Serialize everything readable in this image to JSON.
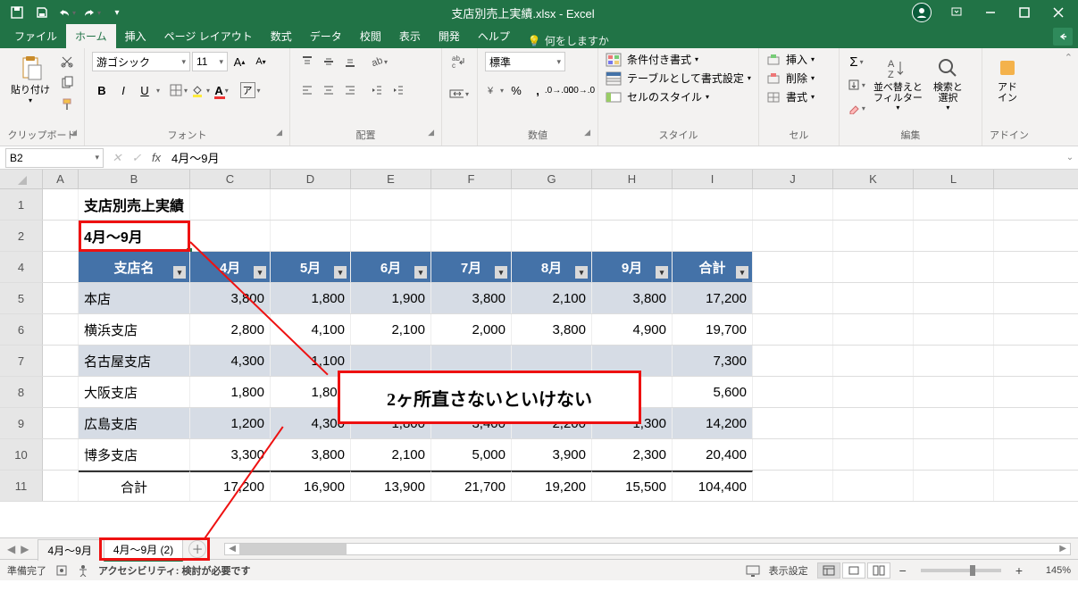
{
  "titlebar": {
    "title": "支店別売上実績.xlsx - Excel"
  },
  "tabs": {
    "file": "ファイル",
    "home": "ホーム",
    "insert": "挿入",
    "pagelayout": "ページ レイアウト",
    "formulas": "数式",
    "data": "データ",
    "review": "校閲",
    "view": "表示",
    "developer": "開発",
    "help": "ヘルプ",
    "tellme": "何をしますか"
  },
  "ribbon": {
    "clipboard": {
      "paste": "貼り付け",
      "label": "クリップボード"
    },
    "font": {
      "name": "游ゴシック",
      "size": "11",
      "label": "フォント"
    },
    "alignment": {
      "label": "配置"
    },
    "number": {
      "format": "標準",
      "label": "数値"
    },
    "styles": {
      "cond": "条件付き書式",
      "table": "テーブルとして書式設定",
      "cell": "セルのスタイル",
      "label": "スタイル"
    },
    "cells": {
      "insert": "挿入",
      "delete": "削除",
      "format": "書式",
      "label": "セル"
    },
    "editing": {
      "sort": "並べ替えと\nフィルター",
      "find": "検索と\n選択",
      "label": "編集"
    },
    "addin": {
      "addin": "アド\nイン",
      "label": "アドイン"
    }
  },
  "fx": {
    "namebox": "B2",
    "formula": "4月～9月"
  },
  "columns": [
    "A",
    "B",
    "C",
    "D",
    "E",
    "F",
    "G",
    "H",
    "I",
    "J",
    "K",
    "L"
  ],
  "sheet": {
    "title": "支店別売上実績",
    "subtitle": "4月～9月",
    "headers": [
      "支店名",
      "4月",
      "5月",
      "6月",
      "7月",
      "8月",
      "9月",
      "合計"
    ],
    "rows": [
      {
        "name": "本店",
        "v": [
          "3,800",
          "1,800",
          "1,900",
          "3,800",
          "2,100",
          "3,800",
          "17,200"
        ]
      },
      {
        "name": "横浜支店",
        "v": [
          "2,800",
          "4,100",
          "2,100",
          "2,000",
          "3,800",
          "4,900",
          "19,700"
        ]
      },
      {
        "name": "名古屋支店",
        "v": [
          "4,300",
          "1,100",
          "",
          "",
          "",
          "",
          "7,300"
        ]
      },
      {
        "name": "大阪支店",
        "v": [
          "1,800",
          "1,800",
          "",
          "",
          "",
          "",
          "5,600"
        ]
      },
      {
        "name": "広島支店",
        "v": [
          "1,200",
          "4,300",
          "1,800",
          "3,400",
          "2,200",
          "1,300",
          "14,200"
        ]
      },
      {
        "name": "博多支店",
        "v": [
          "3,300",
          "3,800",
          "2,100",
          "5,000",
          "3,900",
          "2,300",
          "20,400"
        ]
      }
    ],
    "totals": {
      "name": "合計",
      "v": [
        "17,200",
        "16,900",
        "13,900",
        "21,700",
        "19,200",
        "15,500",
        "104,400"
      ]
    }
  },
  "annotation": "2ヶ所直さないといけない",
  "tabsbar": {
    "tab1": "4月～9月",
    "tab2": "4月～9月 (2)"
  },
  "status": {
    "ready": "準備完了",
    "access": "アクセシビリティ: 検討が必要です",
    "display": "表示設定",
    "zoom": "145%"
  }
}
